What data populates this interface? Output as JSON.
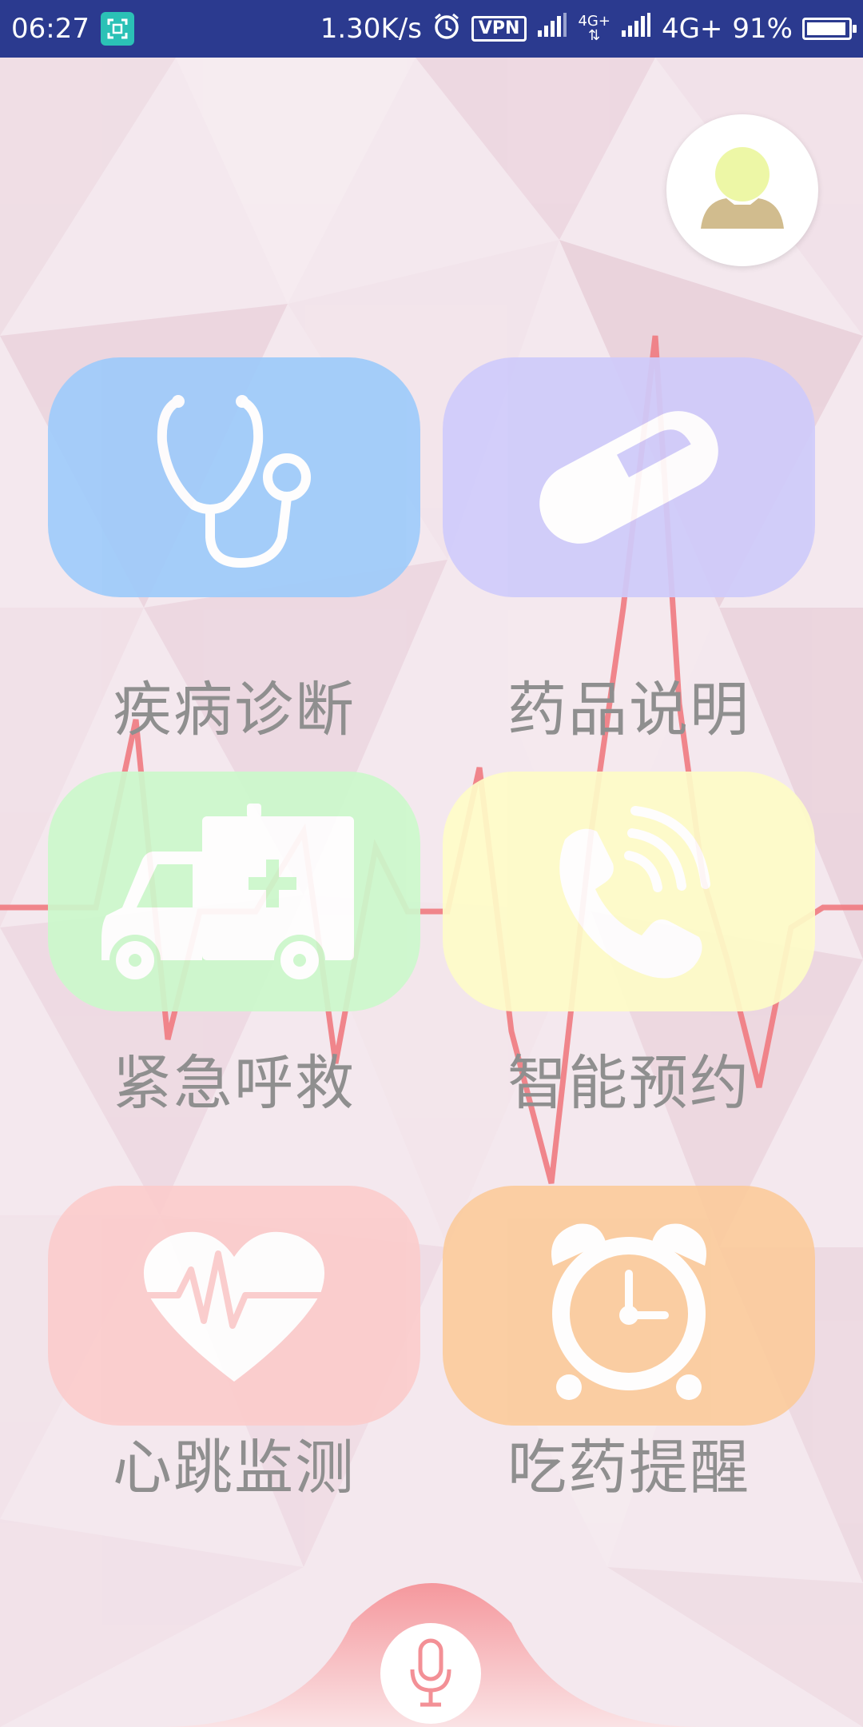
{
  "status_bar": {
    "time": "06:27",
    "net_speed": "1.30K/s",
    "vpn": "VPN",
    "net_type_small": "4G+",
    "net_type": "4G+",
    "battery": "91%"
  },
  "avatar": {
    "icon": "user-avatar-icon"
  },
  "tiles": [
    {
      "label": "疾病诊断",
      "icon": "stethoscope-icon",
      "color": "#9ecbfb"
    },
    {
      "label": "药品说明",
      "icon": "pill-icon",
      "color": "#cfcbfb"
    },
    {
      "label": "紧急呼救",
      "icon": "ambulance-icon",
      "color": "#ccf9cc"
    },
    {
      "label": "智能预约",
      "icon": "phone-icon",
      "color": "#fefcc8"
    },
    {
      "label": "心跳监测",
      "icon": "heartbeat-icon",
      "color": "#fbcccc"
    },
    {
      "label": "吃药提醒",
      "icon": "alarm-clock-icon",
      "color": "#fbcb9c"
    }
  ],
  "mic": {
    "icon": "microphone-icon"
  }
}
